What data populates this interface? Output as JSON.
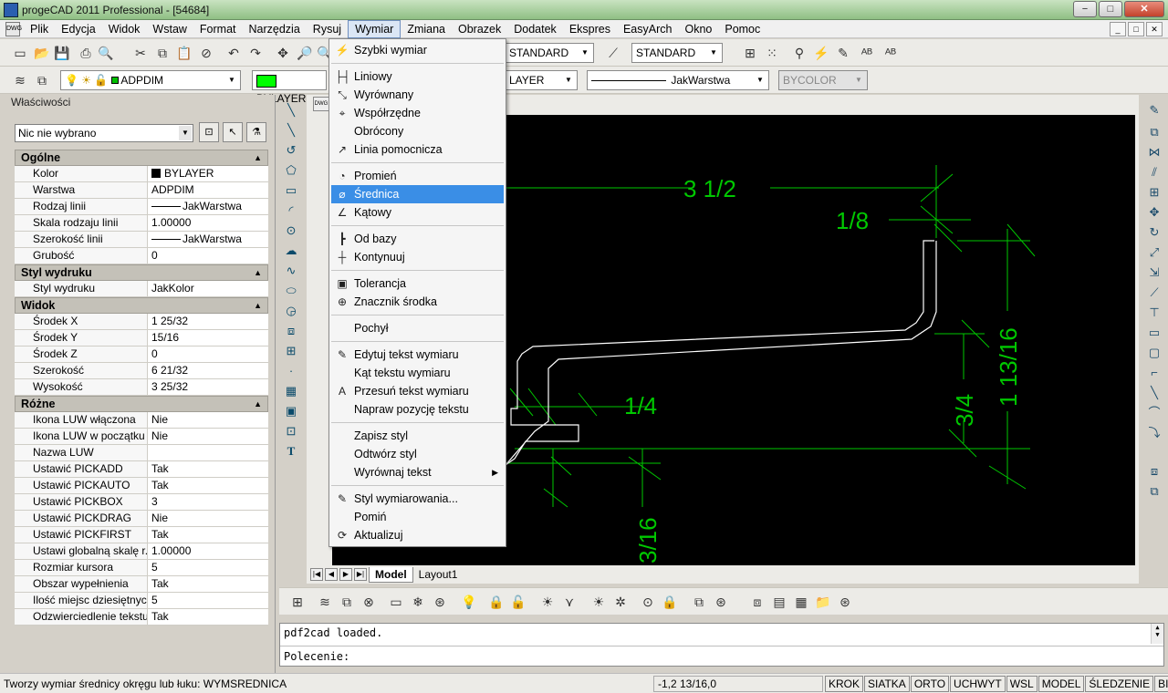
{
  "window": {
    "title": "progeCAD 2011 Professional - [54684]",
    "min": "−",
    "max": "□",
    "close": "✕"
  },
  "menubar": {
    "doc_icon": "DWG",
    "items": [
      "Plik",
      "Edycja",
      "Widok",
      "Wstaw",
      "Format",
      "Narzędzia",
      "Rysuj",
      "Wymiar",
      "Zmiana",
      "Obrazek",
      "Dodatek",
      "Ekspres",
      "EasyArch",
      "Okno",
      "Pomoc"
    ],
    "active": "Wymiar",
    "mdi": [
      "_",
      "□",
      "✕"
    ]
  },
  "toolbar1": {
    "textstyle": "STANDARD",
    "dimstyle": "STANDARD"
  },
  "toolbar2": {
    "layer": "ADPDIM",
    "color_label": "BYLAYER",
    "linetype": "LAYER",
    "lineweight": "JakWarstwa",
    "plotstyle": "BYCOLOR",
    "color_hex": "#00ff00"
  },
  "properties": {
    "title": "Właściwości",
    "selection": "Nic nie wybrano",
    "sections": [
      {
        "name": "Ogólne",
        "rows": [
          {
            "k": "Kolor",
            "v": "BYLAYER",
            "swatch": true
          },
          {
            "k": "Warstwa",
            "v": "ADPDIM"
          },
          {
            "k": "Rodzaj linii",
            "v": "JakWarstwa",
            "line": true
          },
          {
            "k": "Skala rodzaju linii",
            "v": "1.00000"
          },
          {
            "k": "Szerokość linii",
            "v": "JakWarstwa",
            "line": true
          },
          {
            "k": "Grubość",
            "v": "0"
          }
        ]
      },
      {
        "name": "Styl wydruku",
        "rows": [
          {
            "k": "Styl wydruku",
            "v": "JakKolor"
          }
        ]
      },
      {
        "name": "Widok",
        "rows": [
          {
            "k": "Środek X",
            "v": "1 25/32"
          },
          {
            "k": "Środek Y",
            "v": "15/16"
          },
          {
            "k": "Środek Z",
            "v": "0"
          },
          {
            "k": "Szerokość",
            "v": "6 21/32"
          },
          {
            "k": "Wysokość",
            "v": "3 25/32"
          }
        ]
      },
      {
        "name": "Różne",
        "rows": [
          {
            "k": "Ikona LUW włączona",
            "v": "Nie"
          },
          {
            "k": "Ikona LUW w początku",
            "v": "Nie"
          },
          {
            "k": "Nazwa LUW",
            "v": ""
          },
          {
            "k": "Ustawić PICKADD",
            "v": "Tak"
          },
          {
            "k": "Ustawić PICKAUTO",
            "v": "Tak"
          },
          {
            "k": "Ustawić PICKBOX",
            "v": "3"
          },
          {
            "k": "Ustawić PICKDRAG",
            "v": "Nie"
          },
          {
            "k": "Ustawić PICKFIRST",
            "v": "Tak"
          },
          {
            "k": "Ustawi globalną skalę r...",
            "v": "1.00000"
          },
          {
            "k": "Rozmiar kursora",
            "v": "5"
          },
          {
            "k": "Obszar wypełnienia",
            "v": "Tak"
          },
          {
            "k": "Ilość miejsc dziesiętnych",
            "v": "5"
          },
          {
            "k": "Odzwierciedlenie tekstu",
            "v": "Tak"
          }
        ]
      }
    ]
  },
  "dropdown": {
    "items": [
      {
        "label": "Szybki wymiar",
        "icon": "quick-dim-icon",
        "glyph": "⚡"
      },
      {
        "sep": true
      },
      {
        "label": "Liniowy",
        "icon": "linear-dim-icon",
        "glyph": "├┤"
      },
      {
        "label": "Wyrównany",
        "icon": "aligned-dim-icon",
        "glyph": "⤡"
      },
      {
        "label": "Współrzędne",
        "icon": "ordinate-dim-icon",
        "glyph": "⌖"
      },
      {
        "label": "Obrócony",
        "icon": "",
        "glyph": ""
      },
      {
        "label": "Linia pomocnicza",
        "icon": "leader-icon",
        "glyph": "↗"
      },
      {
        "sep": true
      },
      {
        "label": "Promień",
        "icon": "radius-dim-icon",
        "glyph": "◔"
      },
      {
        "label": "Średnica",
        "icon": "diameter-dim-icon",
        "glyph": "⌀",
        "highlight": true
      },
      {
        "label": "Kątowy",
        "icon": "angular-dim-icon",
        "glyph": "∠"
      },
      {
        "sep": true
      },
      {
        "label": "Od bazy",
        "icon": "baseline-dim-icon",
        "glyph": "┣"
      },
      {
        "label": "Kontynuuj",
        "icon": "continue-dim-icon",
        "glyph": "┼"
      },
      {
        "sep": true
      },
      {
        "label": "Tolerancja",
        "icon": "tolerance-icon",
        "glyph": "▣"
      },
      {
        "label": "Znacznik środka",
        "icon": "center-mark-icon",
        "glyph": "⊕"
      },
      {
        "sep": true
      },
      {
        "label": "Pochył",
        "icon": "",
        "glyph": ""
      },
      {
        "sep": true
      },
      {
        "label": "Edytuj tekst wymiaru",
        "icon": "edit-dim-text-icon",
        "glyph": "✎"
      },
      {
        "label": "Kąt tekstu wymiaru",
        "icon": "",
        "glyph": ""
      },
      {
        "label": "Przesuń tekst wymiaru",
        "icon": "move-dim-text-icon",
        "glyph": "A"
      },
      {
        "label": "Napraw pozycję tekstu",
        "icon": "",
        "glyph": ""
      },
      {
        "sep": true
      },
      {
        "label": "Zapisz styl",
        "icon": "",
        "glyph": ""
      },
      {
        "label": "Odtwórz styl",
        "icon": "",
        "glyph": ""
      },
      {
        "label": "Wyrównaj tekst",
        "icon": "",
        "glyph": "",
        "submenu": true
      },
      {
        "sep": true
      },
      {
        "label": "Styl wymiarowania...",
        "icon": "dim-style-icon",
        "glyph": "✎"
      },
      {
        "label": "Pomiń",
        "icon": "",
        "glyph": ""
      },
      {
        "label": "Aktualizuj",
        "icon": "update-dim-icon",
        "glyph": "⟳"
      }
    ]
  },
  "drawing": {
    "dims": [
      "3 1/2",
      "1/8",
      "1 13/16",
      "3/4",
      "1/4",
      "3/16"
    ]
  },
  "layout_tabs": [
    "Model",
    "Layout1"
  ],
  "command": {
    "history": "pdf2cad loaded.",
    "prompt": "Polecenie:"
  },
  "status": {
    "message": "Tworzy wymiar średnicy okręgu lub łuku: WYMSREDNICA",
    "coords": "-1,2 13/16,0",
    "toggles": [
      "KROK",
      "SIATKA",
      "ORTO",
      "UCHWYT",
      "WSL",
      "MODEL",
      "ŚLEDZENIE",
      "BIEGUN"
    ]
  }
}
